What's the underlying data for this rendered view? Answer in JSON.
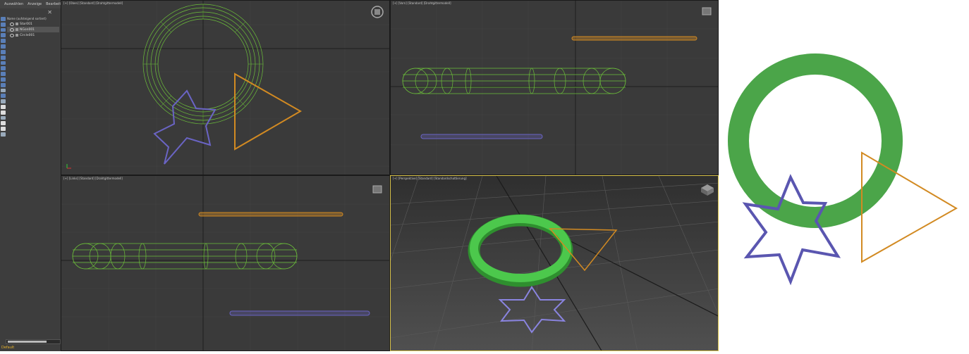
{
  "explorer": {
    "menu": [
      "Auswählen",
      "Anzeige",
      "Bearbeiten"
    ],
    "close": "✕",
    "tree_header": "Name (aufsteigend sortiert)",
    "objects": [
      {
        "label": "Star001",
        "selected": false
      },
      {
        "label": "NGon001",
        "selected": true
      },
      {
        "label": "Circle001",
        "selected": false
      }
    ],
    "layer": "Default"
  },
  "viewports": {
    "top_left": "[+] [Oben] [Standard] [Drahtgittermodell]",
    "top_right": "[+] [Vorn] [Standard] [Drahtgittermodell]",
    "bottom_left": "[+] [Links] [Standard] [Drahtgittermodell]",
    "bottom_right": "[+] [Perspektive] [Standard] [Standardschattierung]"
  },
  "colors": {
    "torus": "#4cae4c",
    "wire_torus": "#6cbf3a",
    "star": "#6a64c4",
    "triangle": "#d28a22",
    "viewport_bg": "#3a3a3a",
    "active_border": "#d8c24a"
  }
}
